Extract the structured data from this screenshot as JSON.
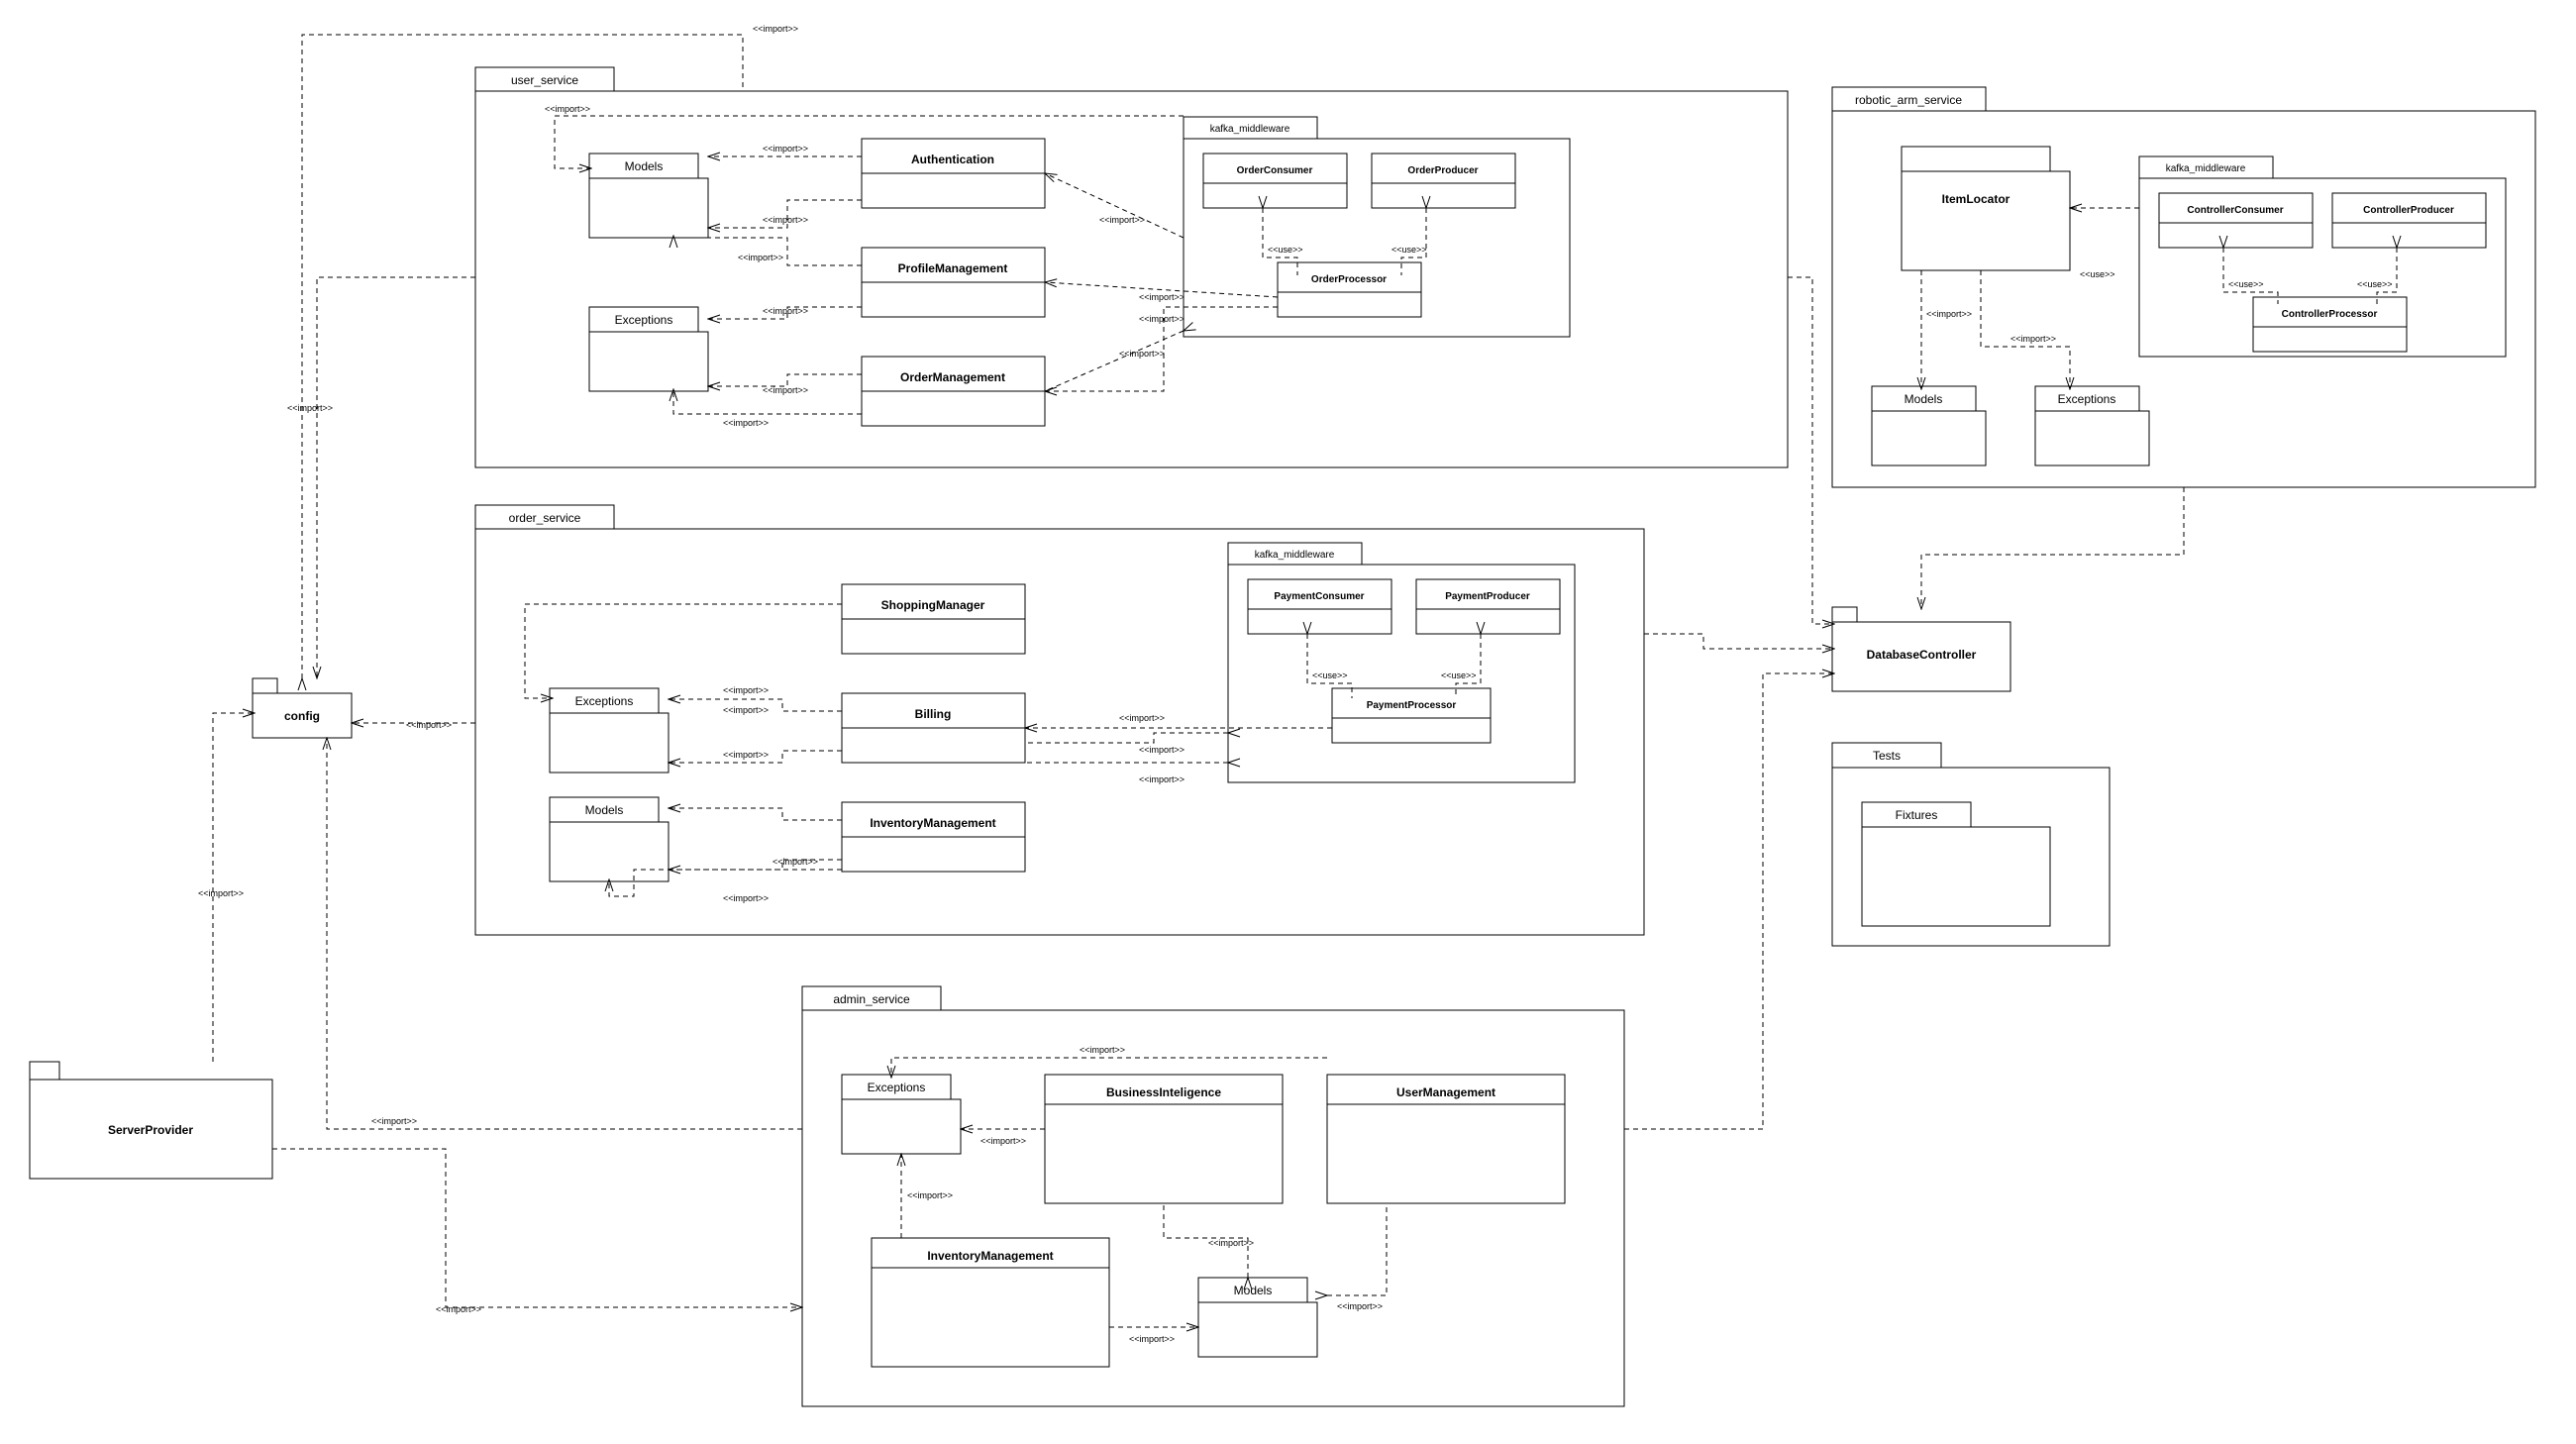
{
  "stereo": {
    "import": "<<import>>",
    "use": "<<use>>"
  },
  "packages": {
    "user_service": "user_service",
    "order_service": "order_service",
    "admin_service": "admin_service",
    "robotic_arm_service": "robotic_arm_service",
    "kafka_middleware": "kafka_middleware",
    "tests": "Tests"
  },
  "classes": {
    "config": "config",
    "server_provider": "ServerProvider",
    "database_controller": "DatabaseController",
    "fixtures": "Fixtures",
    "models": "Models",
    "exceptions": "Exceptions",
    "authentication": "Authentication",
    "profile_management": "ProfileManagement",
    "order_management": "OrderManagement",
    "order_consumer": "OrderConsumer",
    "order_producer": "OrderProducer",
    "order_processor": "OrderProcessor",
    "shopping_manager": "ShoppingManager",
    "billing": "Billing",
    "inventory_management": "InventoryManagement",
    "payment_consumer": "PaymentConsumer",
    "payment_producer": "PaymentProducer",
    "payment_processor": "PaymentProcessor",
    "business_intelligence": "BusinessInteligence",
    "user_management": "UserManagement",
    "item_locator": "ItemLocator",
    "controller_consumer": "ControllerConsumer",
    "controller_producer": "ControllerProducer",
    "controller_processor": "ControllerProcessor"
  }
}
